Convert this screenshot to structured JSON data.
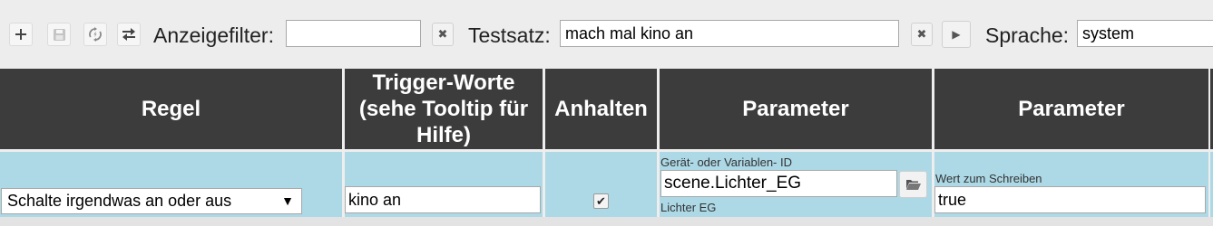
{
  "toolbar": {
    "filter_label": "Anzeigefilter:",
    "filter_value": "",
    "testsatz_label": "Testsatz:",
    "testsatz_value": "mach mal kino an",
    "sprache_label": "Sprache:",
    "sprache_value": "system",
    "buttons": [
      "plus-icon",
      "save-icon",
      "refresh-icon",
      "swap-icon"
    ],
    "clear_glyph": "✖",
    "play_glyph": "▶"
  },
  "table": {
    "headers": [
      "Regel",
      "Trigger-Worte (sehe Tooltip für Hilfe)",
      "Anhalten",
      "Parameter",
      "Parameter"
    ],
    "row": {
      "rule": "Schalte irgendwas an oder aus",
      "trigger": "kino an",
      "halt_checked": true,
      "param1_hint": "Gerät- oder Variablen- ID",
      "param1_value": "scene.Lichter_EG",
      "param1_name": "Lichter EG",
      "param2_hint": "Wert zum Schreiben",
      "param2_value": "true"
    }
  },
  "colors": {
    "header_bg": "#3c3c3c",
    "row_bg": "#add8e6",
    "page_bg": "#eeeeee"
  }
}
